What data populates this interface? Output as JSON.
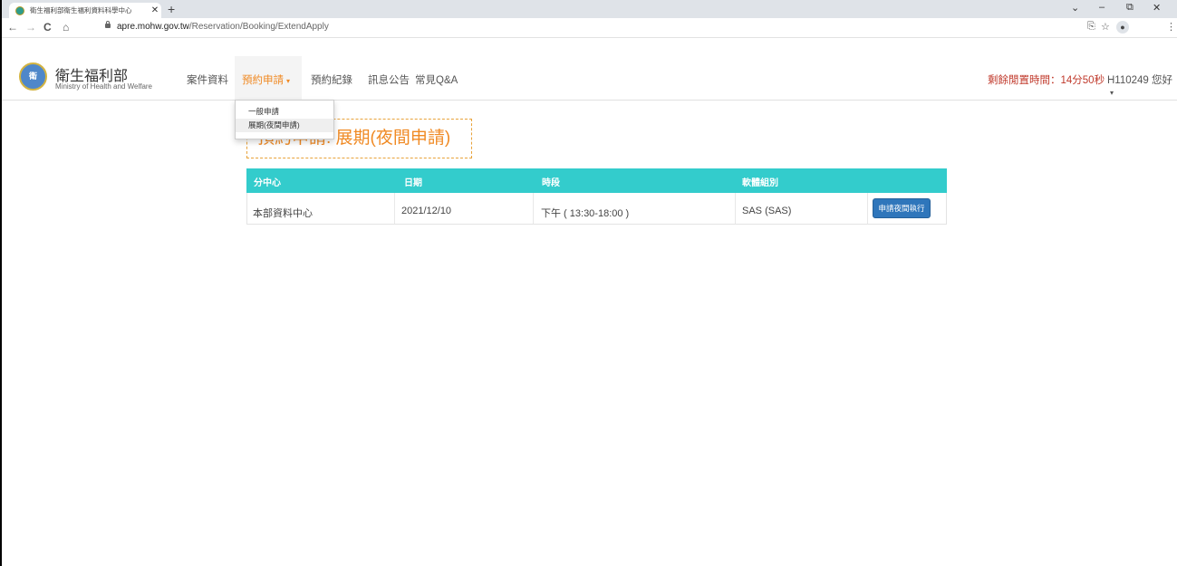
{
  "browser": {
    "tab_title": "衛生福利部衛生福利資料科學中心",
    "tab_close": "✕",
    "new_tab": "+",
    "url_domain": "apre.mohw.gov.tw",
    "url_path": "/Reservation/Booking/ExtendApply",
    "nav": {
      "back": "←",
      "forward": "→",
      "reload": "C",
      "home": "⌂"
    },
    "window": {
      "chevron": "⌄",
      "minimize": "–",
      "restore": "⧉",
      "close": "✕"
    },
    "toolbar_right": {
      "share": "⎘",
      "star": "☆",
      "menu": "⋮"
    }
  },
  "site": {
    "brand_title": "衛生福利部",
    "brand_subtitle": "Ministry of Health and Welfare",
    "logo_text": "衛"
  },
  "nav": {
    "items": [
      "案件資料",
      "預約申請",
      "預約紀錄",
      "訊息公告",
      "常見Q&A"
    ],
    "active_index": 1,
    "active_caret": "▾"
  },
  "session": {
    "remaining": "剩餘閒置時間：14分50秒",
    "user": "H110249 您好",
    "user_caret": "▾"
  },
  "dropdown": {
    "items": [
      "一般申請",
      "展期(夜間申請)"
    ],
    "hover_index": 1
  },
  "page": {
    "title": "預約申請: 展期(夜間申請)"
  },
  "table": {
    "headers": [
      "分中心",
      "日期",
      "時段",
      "軟體組別",
      ""
    ],
    "rows": [
      {
        "center": "本部資料中心",
        "date": "2021/12/10",
        "period": "下午 ( 13:30-18:00 )",
        "software": "SAS (SAS)",
        "action": "申請夜間執行"
      }
    ]
  },
  "colors": {
    "accent_orange": "#f08a24",
    "table_header": "#33cccc",
    "button_blue": "#2f76bb",
    "session_red": "#c0392b"
  }
}
